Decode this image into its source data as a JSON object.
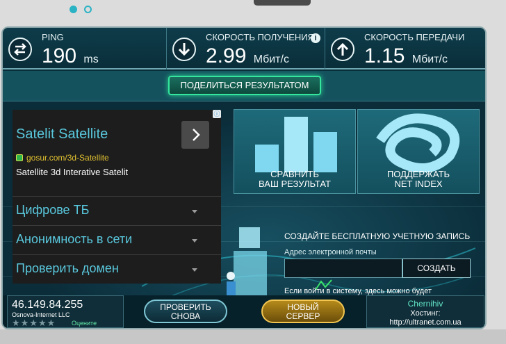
{
  "stats": {
    "ping": {
      "label": "PING",
      "value": "190",
      "unit": "ms"
    },
    "download": {
      "label": "СКОРОСТЬ ПОЛУЧЕНИЯ",
      "value": "2.99",
      "unit": "Мбит/с",
      "info_glyph": "i"
    },
    "upload": {
      "label": "СКОРОСТЬ ПЕРЕДАЧИ",
      "value": "1.15",
      "unit": "Мбит/с"
    }
  },
  "share": {
    "label": "ПОДЕЛИТЬСЯ РЕЗУЛЬТАТОМ"
  },
  "tiles": {
    "compare": {
      "line1": "СРАВНИТЬ",
      "line2": "ВАШ РЕЗУЛЬТАТ"
    },
    "support": {
      "line1": "ПОДДЕРЖАТЬ",
      "line2": "NET INDEX"
    }
  },
  "signup": {
    "title": "СОЗДАЙТЕ БЕСПЛАТНУЮ УЧЕТНУЮ ЗАПИСЬ",
    "email_label": "Адрес электронной почты",
    "email_value": "",
    "create_label": "СОЗДАТЬ",
    "note": "Если войти в систему, здесь можно будет начать турнир Speed Wave!"
  },
  "isp": {
    "ip": "46.149.84.255",
    "name": "Osnova-Internet LLC",
    "rating": 0,
    "rate_label": "Оцените"
  },
  "actions": {
    "again_line1": "ПРОВЕРИТЬ",
    "again_line2": "СНОВА",
    "server_line1": "НОВЫЙ",
    "server_line2": "СЕРВЕР"
  },
  "host": {
    "city": "Chernihiv",
    "label": "Хостинг:",
    "url": "http://ultranet.com.ua"
  },
  "ad": {
    "close_glyph": "ⓘ",
    "title": "Satelit Satellite",
    "url": "gosur.com/3d-Satellite",
    "description": "Satellite 3d Interative Satelit",
    "items": [
      "Цифрове ТБ",
      "Анонимность в сети",
      "Проверить домен"
    ]
  },
  "colors": {
    "accent": "#2ab3c4",
    "green": "#34e69e",
    "gold": "#f2c651",
    "panel": "#0a2d3a"
  }
}
